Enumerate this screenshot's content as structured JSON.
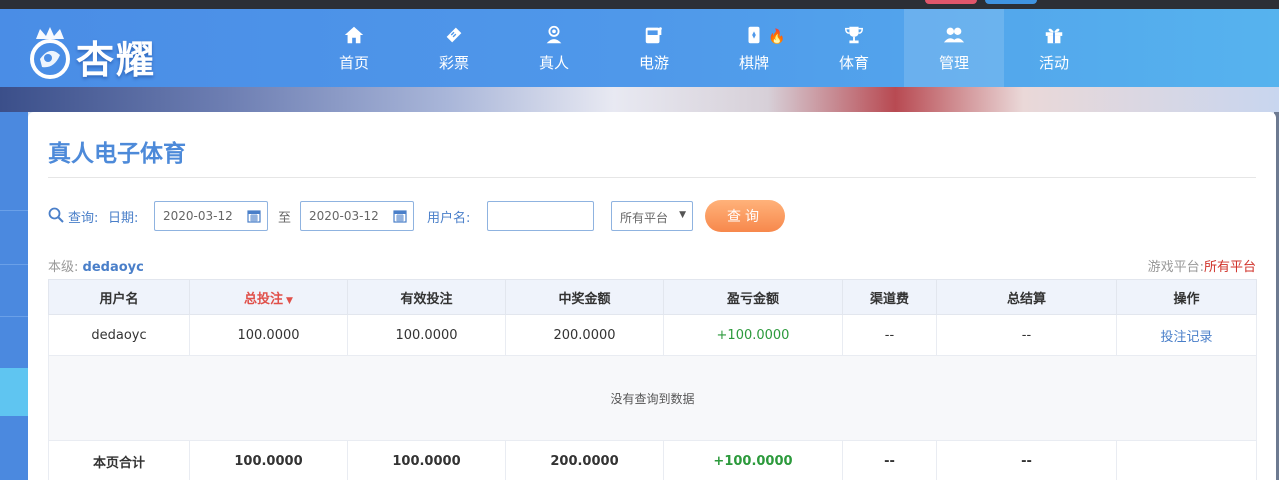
{
  "brand": {
    "name": "杏耀"
  },
  "nav": [
    {
      "label": "首页",
      "icon": "home-icon"
    },
    {
      "label": "彩票",
      "icon": "lottery-ticket-icon"
    },
    {
      "label": "真人",
      "icon": "live-dealer-icon"
    },
    {
      "label": "电游",
      "icon": "slot-machine-icon"
    },
    {
      "label": "棋牌",
      "icon": "card-game-icon",
      "badge": "hot-flame-icon"
    },
    {
      "label": "体育",
      "icon": "trophy-icon"
    },
    {
      "label": "管理",
      "icon": "users-icon",
      "active": true
    },
    {
      "label": "活动",
      "icon": "gift-icon"
    }
  ],
  "page": {
    "title": "真人电子体育"
  },
  "query": {
    "label": "查询:",
    "date_label": "日期:",
    "date_from": "2020-03-12",
    "to_label": "至",
    "date_to": "2020-03-12",
    "username_label": "用户名:",
    "username_value": "",
    "platform_selected": "所有平台",
    "button_label": "查询"
  },
  "info": {
    "level_label": "本级:",
    "level_user": "dedaoyc",
    "platform_label": "游戏平台:",
    "platform_value": "所有平台"
  },
  "table": {
    "headers": [
      "用户名",
      "总投注",
      "有效投注",
      "中奖金额",
      "盈亏金额",
      "渠道费",
      "总结算",
      "操作"
    ],
    "sorted_column": "总投注",
    "row": {
      "username": "dedaoyc",
      "total_bet": "100.0000",
      "valid_bet": "100.0000",
      "win_amount": "200.0000",
      "profit": "+100.0000",
      "channel_fee": "--",
      "settlement": "--",
      "action": "投注记录"
    },
    "empty_message": "没有查询到数据",
    "total": {
      "label": "本页合计",
      "total_bet": "100.0000",
      "valid_bet": "100.0000",
      "win_amount": "200.0000",
      "profit": "+100.0000",
      "channel_fee": "--",
      "settlement": "--",
      "action": ""
    }
  },
  "colors": {
    "header_blue": "#4a8de6",
    "title_blue": "#4d8ad9",
    "profit_green": "#2c9a3c",
    "button_orange": "#f7884c",
    "sort_red": "#e0504a"
  }
}
